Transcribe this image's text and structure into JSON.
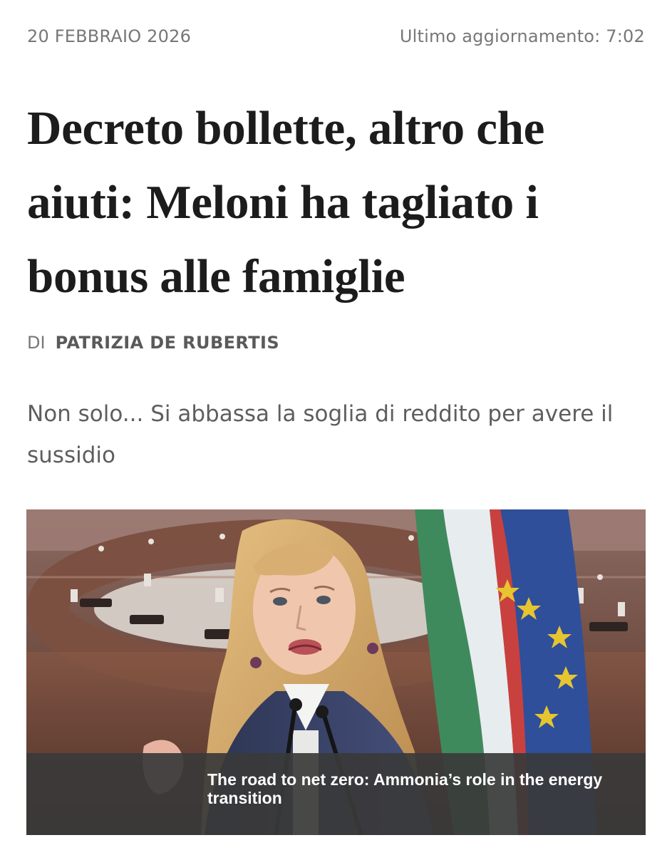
{
  "article": {
    "date": "20 FEBBRAIO 2026",
    "last_update": "Ultimo aggiornamento: 7:02",
    "headline": "Decreto bollette, altro che aiuti: Meloni ha tagliato i bonus alle famiglie",
    "byline_prefix": "DI",
    "author": "PATRIZIA DE RUBERTIS",
    "summary": "Non solo... Si abbassa la soglia di reddito per avere il sussidio"
  },
  "media": {
    "overlay_caption": "The road to net zero: Ammonia’s role in the energy transition"
  },
  "colors": {
    "text_primary": "#1c1c1c",
    "text_muted": "#777777",
    "overlay": "#3a3a3a",
    "flag_green": "#3f8a5c",
    "flag_red": "#c8413f",
    "eu_blue": "#2f4f9a",
    "eu_star": "#e7c531"
  }
}
